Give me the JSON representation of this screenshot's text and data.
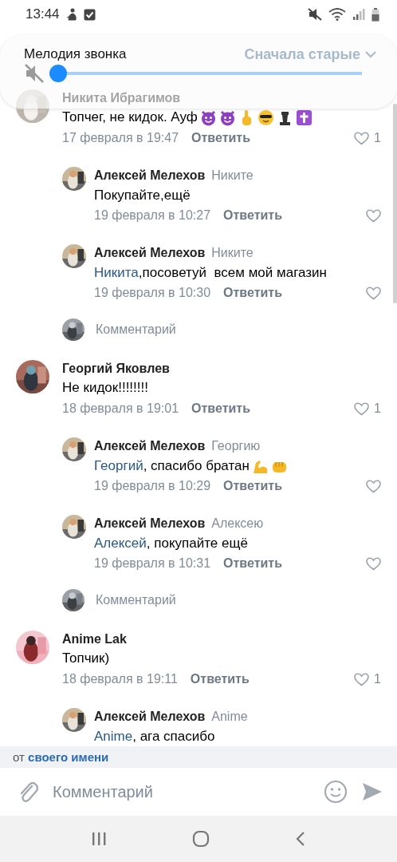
{
  "status_bar": {
    "time": "13:44"
  },
  "header": {
    "sort_label": "Сначала старые"
  },
  "volume_panel": {
    "title": "Мелодия звонка",
    "muted": true,
    "level": 0
  },
  "comments": [
    {
      "author": "Никита Ибрагимов",
      "text": "Топчег, не кидок. Ауф",
      "emoji": [
        {
          "kind": "devil"
        },
        {
          "kind": "devil"
        },
        {
          "kind": "finger"
        },
        {
          "kind": "sunglasses"
        },
        {
          "kind": "chess"
        },
        {
          "kind": "cross"
        }
      ],
      "date": "17 февраля в 19:47",
      "reply_label": "Ответить",
      "likes": "1",
      "replies": [
        {
          "author": "Алексей Мелехов",
          "to": "Никите",
          "text": "Покупайте,ещё",
          "date": "19 февраля в 10:27",
          "reply_label": "Ответить"
        },
        {
          "author": "Алексей Мелехов",
          "to": "Никите",
          "mention": "Никита",
          "text": ",посоветуй  всем мой магазин",
          "date": "19 февраля в 10:30",
          "reply_label": "Ответить"
        }
      ],
      "reply_field": {
        "placeholder": "Комментарий"
      }
    },
    {
      "author": "Георгий Яковлев",
      "text": "Не кидок!!!!!!!!",
      "date": "18 февраля в 19:01",
      "reply_label": "Ответить",
      "likes": "1",
      "replies": [
        {
          "author": "Алексей Мелехов",
          "to": "Георгию",
          "mention": "Георгий",
          "text": ", спасибо братан",
          "emoji": [
            {
              "kind": "muscle"
            },
            {
              "kind": "fist"
            }
          ],
          "date": "19 февраля в 10:29",
          "reply_label": "Ответить"
        },
        {
          "author": "Алексей Мелехов",
          "to": "Алексею",
          "mention": "Алексей",
          "text": ", покупайте ещё",
          "date": "19 февраля в 10:31",
          "reply_label": "Ответить"
        }
      ],
      "reply_field": {
        "placeholder": "Комментарий"
      }
    },
    {
      "author": "Anime Lak",
      "text": "Топчик)",
      "date": "18 февраля в 19:11",
      "reply_label": "Ответить",
      "likes": "1",
      "replies": [
        {
          "author": "Алексей Мелехов",
          "to": "Anime",
          "mention": "Anime",
          "text": ", ага спасибо"
        }
      ]
    }
  ],
  "composer": {
    "from_prefix": "от",
    "from_link": "своего имени",
    "placeholder": "Комментарий"
  }
}
